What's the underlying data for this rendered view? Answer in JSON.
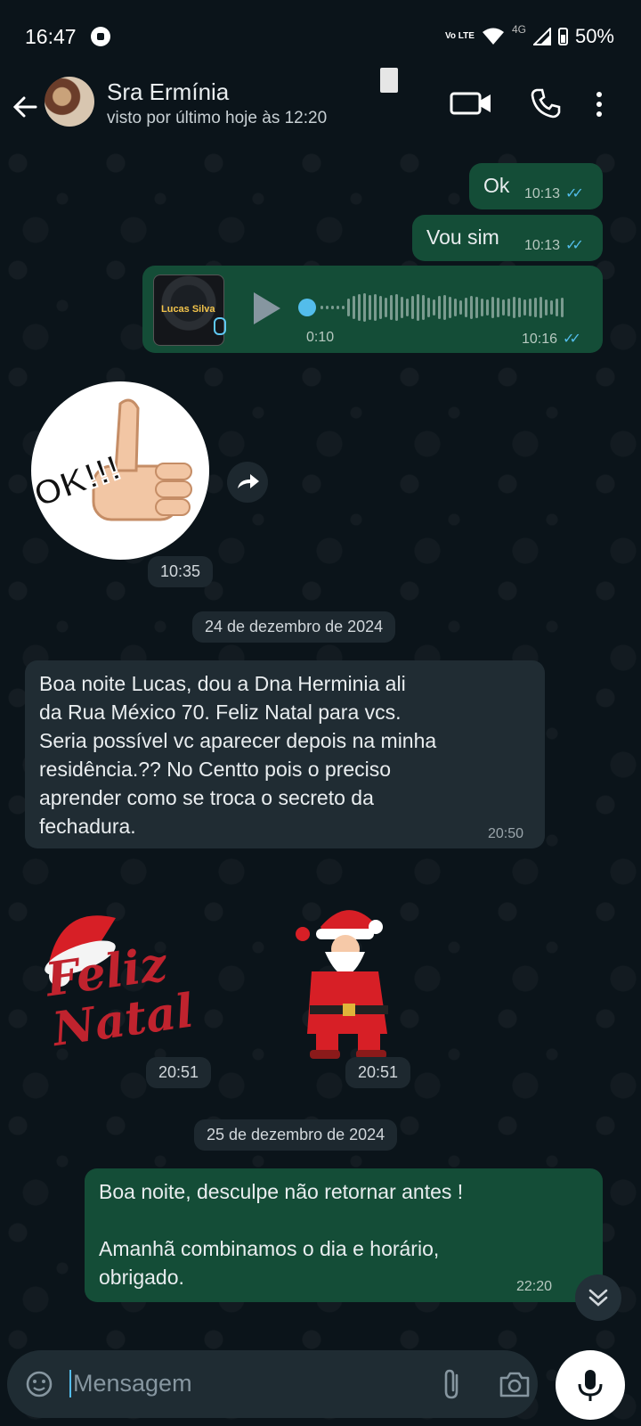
{
  "status_bar": {
    "time": "16:47",
    "volte": "Vo LTE",
    "network": "4G",
    "battery": "50%"
  },
  "header": {
    "contact_name": "Sra Ermínia",
    "last_seen": "visto por último hoje às 12:20"
  },
  "messages": [
    {
      "direction": "out",
      "text": "Ok",
      "time": "10:13"
    },
    {
      "direction": "out",
      "text": "Vou sim",
      "time": "10:13"
    },
    {
      "direction": "out",
      "type": "audio",
      "thumb_label": "Lucas Silva",
      "duration": "0:10",
      "time": "10:16"
    },
    {
      "direction": "in",
      "type": "sticker",
      "sticker_text": "OK!!!",
      "time": "10:35"
    },
    {
      "type": "date",
      "text": "24 de dezembro de 2024"
    },
    {
      "direction": "in",
      "lines": [
        "Boa noite Lucas, dou a Dna Herminia ali",
        "da Rua México 70. Feliz Natal para vcs.",
        "Seria possível vc aparecer depois na minha",
        "residência.?? No Centto pois o preciso",
        "aprender como se troca o secreto da",
        "fechadura."
      ],
      "time": "20:50"
    },
    {
      "direction": "in",
      "type": "sticker",
      "sticker_text": "Feliz Natal",
      "time": "20:51"
    },
    {
      "direction": "in",
      "type": "sticker",
      "time": "20:51"
    },
    {
      "type": "date",
      "text": "25 de dezembro de 2024"
    },
    {
      "direction": "out",
      "lines": [
        "Boa noite, desculpe não retornar antes !",
        "",
        "Amanhã combinamos o dia e horário,",
        "obrigado."
      ],
      "time": "22:20"
    }
  ],
  "input": {
    "placeholder": "Mensagem"
  }
}
